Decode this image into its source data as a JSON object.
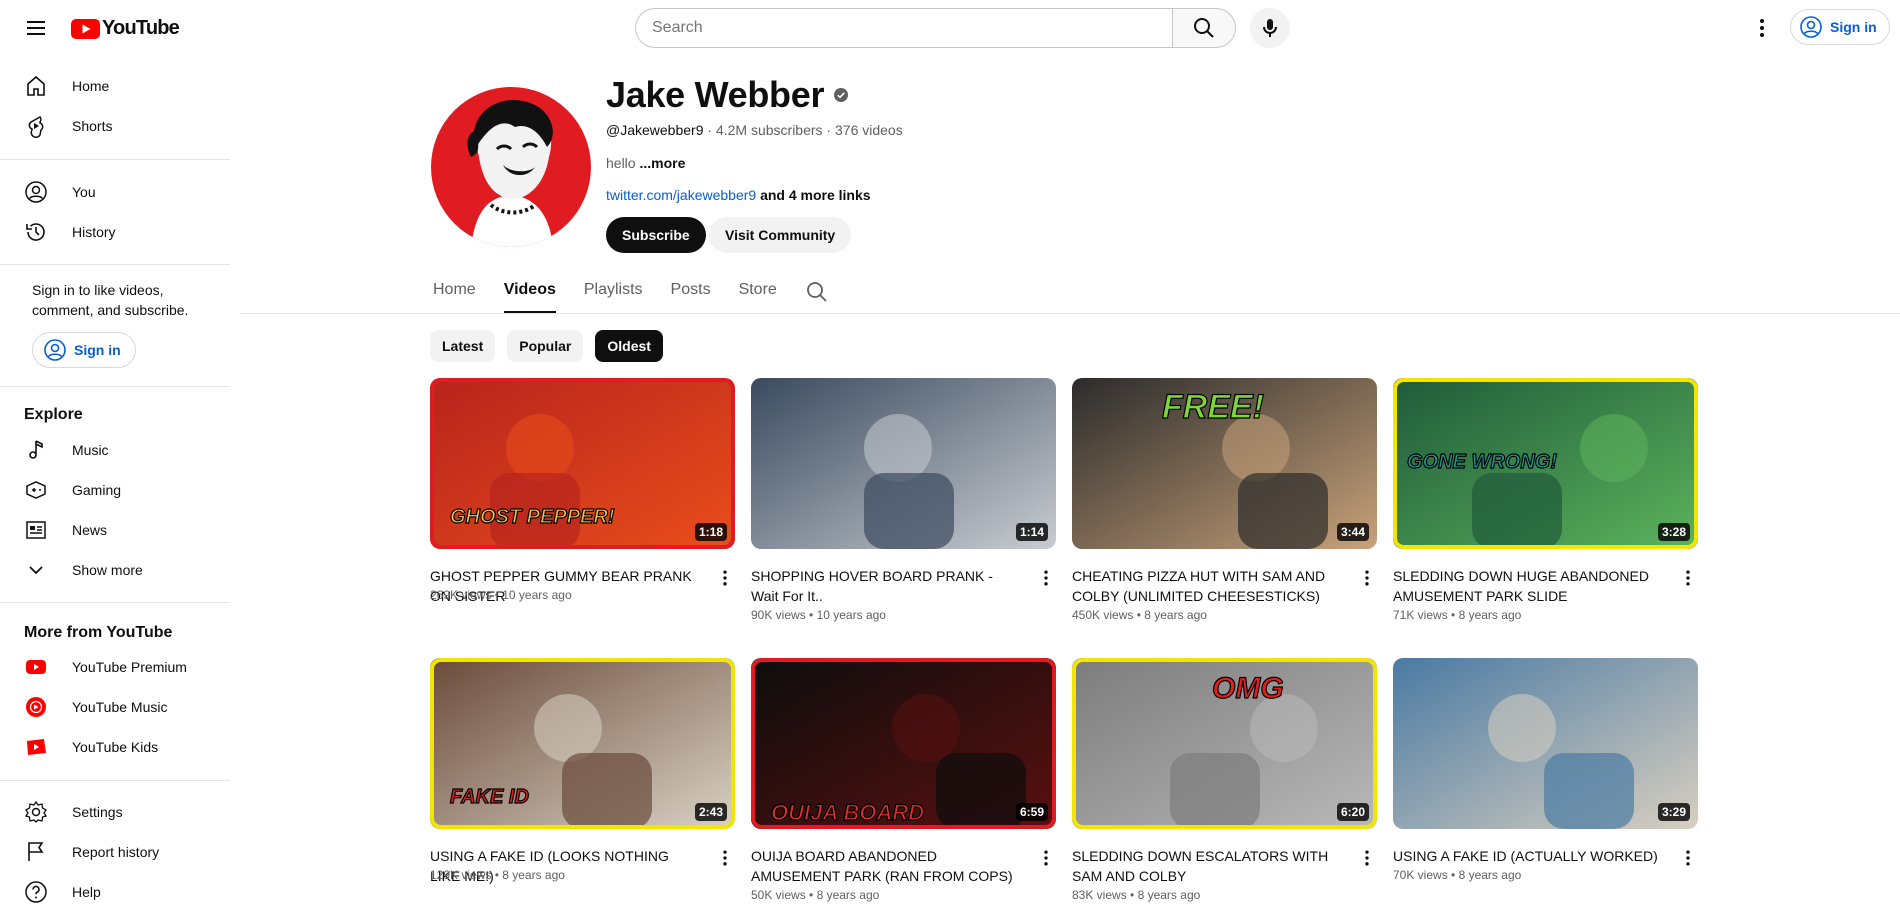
{
  "header": {
    "logo_text": "YouTube",
    "search_placeholder": "Search",
    "signin_label": "Sign in"
  },
  "sidebar": {
    "main": [
      {
        "label": "Home",
        "icon": "home-icon"
      },
      {
        "label": "Shorts",
        "icon": "shorts-icon"
      }
    ],
    "you": [
      {
        "label": "You",
        "icon": "you-icon"
      },
      {
        "label": "History",
        "icon": "history-icon"
      }
    ],
    "signin_prompt": "Sign in to like videos, comment, and subscribe.",
    "signin_label": "Sign in",
    "explore_heading": "Explore",
    "explore": [
      {
        "label": "Music",
        "icon": "music-icon"
      },
      {
        "label": "Gaming",
        "icon": "gaming-icon"
      },
      {
        "label": "News",
        "icon": "news-icon"
      },
      {
        "label": "Show more",
        "icon": "chevron-down-icon"
      }
    ],
    "more_heading": "More from YouTube",
    "more": [
      {
        "label": "YouTube Premium",
        "icon": "youtube-premium-icon"
      },
      {
        "label": "YouTube Music",
        "icon": "youtube-music-icon"
      },
      {
        "label": "YouTube Kids",
        "icon": "youtube-kids-icon"
      }
    ],
    "footer": [
      {
        "label": "Settings",
        "icon": "gear-icon"
      },
      {
        "label": "Report history",
        "icon": "flag-icon"
      },
      {
        "label": "Help",
        "icon": "help-icon"
      }
    ]
  },
  "channel": {
    "name": "Jake Webber",
    "handle": "@Jakewebber9",
    "subscribers": "4.2M subscribers",
    "videos_count": "376 videos",
    "separator": " · ",
    "description": "hello",
    "more_label": "...more",
    "link": "twitter.com/jakewebber9",
    "more_links": "and 4 more links",
    "subscribe_label": "Subscribe",
    "community_label": "Visit Community"
  },
  "tabs": [
    "Home",
    "Videos",
    "Playlists",
    "Posts",
    "Store"
  ],
  "active_tab": "Videos",
  "chips": [
    "Latest",
    "Popular",
    "Oldest"
  ],
  "active_chip": "Oldest",
  "videos": [
    {
      "title": "GHOST PEPPER GUMMY BEAR PRANK ON SISTER",
      "views": "269K views",
      "age": "10 years ago",
      "duration": "1:18",
      "overlay": "GHOST PEPPER!",
      "colors": [
        "#b7231c",
        "#e94e1b",
        "#f2c94c"
      ]
    },
    {
      "title": "SHOPPING HOVER BOARD PRANK - Wait For It..",
      "views": "90K views",
      "age": "10 years ago",
      "duration": "1:14",
      "overlay": "",
      "colors": [
        "#3a4a5e",
        "#c9ccd1",
        "#6b7a8c"
      ]
    },
    {
      "title": "CHEATING PIZZA HUT WITH SAM AND COLBY (UNLIMITED CHEESESTICKS)",
      "views": "450K views",
      "age": "8 years ago",
      "duration": "3:44",
      "overlay": "FREE!",
      "colors": [
        "#2b2b2b",
        "#c8a27a",
        "#7ad63a"
      ]
    },
    {
      "title": "SLEDDING DOWN HUGE ABANDONED AMUSEMENT PARK SLIDE",
      "views": "71K views",
      "age": "8 years ago",
      "duration": "3:28",
      "overlay": "GONE WRONG!",
      "colors": [
        "#1f5a3a",
        "#5cb35c",
        "#1a9a9a"
      ]
    },
    {
      "title": "USING A FAKE ID (LOOKS NOTHING LIKE ME!)",
      "views": "129K views",
      "age": "8 years ago",
      "duration": "2:43",
      "overlay": "FAKE ID",
      "colors": [
        "#6a4a3a",
        "#d9d2c5",
        "#e02020"
      ]
    },
    {
      "title": "OUIJA BOARD ABANDONED AMUSEMENT PARK (RAN FROM COPS)",
      "views": "50K views",
      "age": "8 years ago",
      "duration": "6:59",
      "overlay": "OUIJA BOARD",
      "colors": [
        "#0d0d0d",
        "#5a1010",
        "#e03030"
      ]
    },
    {
      "title": "SLEDDING DOWN ESCALATORS WITH SAM AND COLBY",
      "views": "83K views",
      "age": "8 years ago",
      "duration": "6:20",
      "overlay": "OMG",
      "colors": [
        "#7c7c7c",
        "#b9b9b9",
        "#e02020"
      ]
    },
    {
      "title": "USING A FAKE ID (ACTUALLY WORKED)",
      "views": "70K views",
      "age": "8 years ago",
      "duration": "3:29",
      "overlay": "",
      "colors": [
        "#4a7aa3",
        "#d8cfc0",
        "#2a2a2a"
      ]
    }
  ],
  "colors": {
    "brand_red": "#ff0000",
    "link_blue": "#065fd4",
    "text": "#0f0f0f",
    "muted": "#606060"
  }
}
